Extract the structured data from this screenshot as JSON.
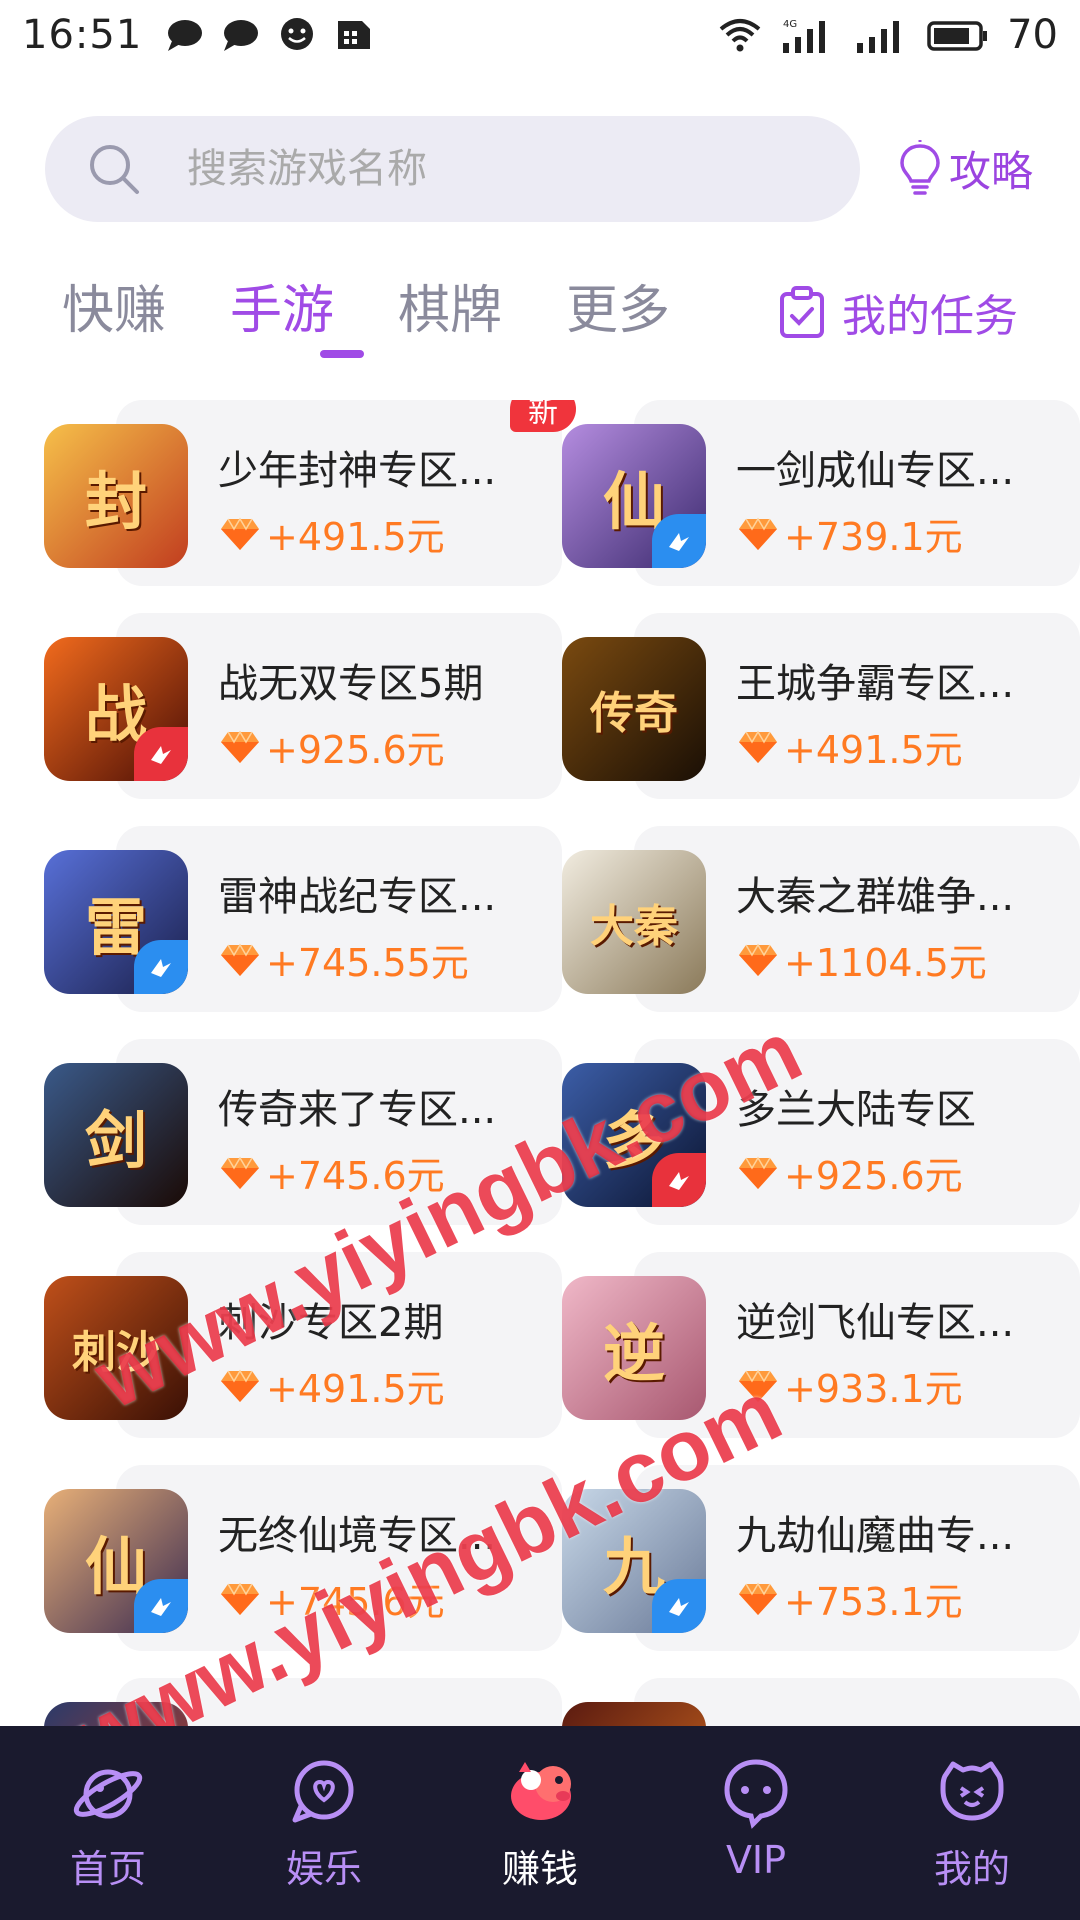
{
  "status_bar": {
    "time": "16:51",
    "left_icons": [
      "chat-bubble-icon",
      "chat-bubble-icon",
      "smile-chat-icon",
      "sim-card-icon"
    ],
    "right_icons": [
      "wifi-icon",
      "signal-4g-icon",
      "signal-icon",
      "battery-icon"
    ],
    "battery": "70"
  },
  "search": {
    "placeholder": "搜索游戏名称"
  },
  "guide": {
    "label": "攻略"
  },
  "tabs": [
    {
      "label": "快赚",
      "active": false
    },
    {
      "label": "手游",
      "active": true
    },
    {
      "label": "棋牌",
      "active": false
    },
    {
      "label": "更多",
      "active": false
    }
  ],
  "my_tasks": {
    "label": "我的任务"
  },
  "games": [
    {
      "name": "少年封神专区...",
      "reward": "+491.5元",
      "badge_new": "新",
      "icon_glyph": "封",
      "icon_colors": [
        "#f6c04a",
        "#c13d1f"
      ],
      "corner": ""
    },
    {
      "name": "一剑成仙专区...",
      "reward": "+739.1元",
      "badge_new": "",
      "icon_glyph": "仙",
      "icon_colors": [
        "#b58de0",
        "#3b2a6e"
      ],
      "corner": "blue"
    },
    {
      "name": "战无双专区5期",
      "reward": "+925.6元",
      "badge_new": "",
      "icon_glyph": "战",
      "icon_colors": [
        "#f26b1d",
        "#4a0d05"
      ],
      "corner": "red"
    },
    {
      "name": "王城争霸专区...",
      "reward": "+491.5元",
      "badge_new": "",
      "icon_glyph": "传奇",
      "icon_colors": [
        "#7a4a10",
        "#1a0f05"
      ],
      "corner": ""
    },
    {
      "name": "雷神战纪专区...",
      "reward": "+745.55元",
      "badge_new": "",
      "icon_glyph": "雷",
      "icon_colors": [
        "#5870d8",
        "#1a1f4a"
      ],
      "corner": "blue"
    },
    {
      "name": "大秦之群雄争...",
      "reward": "+1104.5元",
      "badge_new": "",
      "icon_glyph": "大秦",
      "icon_colors": [
        "#f1ece0",
        "#8b7a5a"
      ],
      "corner": ""
    },
    {
      "name": "传奇来了专区...",
      "reward": "+745.6元",
      "badge_new": "",
      "icon_glyph": "剑",
      "icon_colors": [
        "#3a5a8a",
        "#1a0a05"
      ],
      "corner": ""
    },
    {
      "name": "多兰大陆专区",
      "reward": "+925.6元",
      "badge_new": "",
      "icon_glyph": "多",
      "icon_colors": [
        "#3c5ea8",
        "#0b1430"
      ],
      "corner": "red"
    },
    {
      "name": "刺沙专区2期",
      "reward": "+491.5元",
      "badge_new": "",
      "icon_glyph": "刺沙",
      "icon_colors": [
        "#c0501a",
        "#3a1005"
      ],
      "corner": ""
    },
    {
      "name": "逆剑飞仙专区...",
      "reward": "+933.1元",
      "badge_new": "",
      "icon_glyph": "逆",
      "icon_colors": [
        "#f0b8c8",
        "#a85870"
      ],
      "corner": ""
    },
    {
      "name": "无终仙境专区...",
      "reward": "+745.6元",
      "badge_new": "",
      "icon_glyph": "仙",
      "icon_colors": [
        "#e8b078",
        "#3a2a50"
      ],
      "corner": "blue"
    },
    {
      "name": "九劫仙魔曲专...",
      "reward": "+753.1元",
      "badge_new": "",
      "icon_glyph": "九",
      "icon_colors": [
        "#c8d8e8",
        "#6a7a98"
      ],
      "corner": "blue"
    },
    {
      "name": "",
      "reward": "",
      "badge_new": "",
      "icon_glyph": "",
      "icon_colors": [
        "#2a3a6a",
        "#c03a20"
      ],
      "corner": ""
    },
    {
      "name": "",
      "reward": "",
      "badge_new": "",
      "icon_glyph": "",
      "icon_colors": [
        "#5a1a10",
        "#d06a20"
      ],
      "corner": ""
    }
  ],
  "watermarks": [
    "www.yiyingbk.com",
    "www.yiyingbk.com"
  ],
  "bottom_nav": [
    {
      "label": "首页",
      "icon": "planet-icon",
      "active": false
    },
    {
      "label": "娱乐",
      "icon": "heart-chat-icon",
      "active": false
    },
    {
      "label": "赚钱",
      "icon": "piggy-bank-icon",
      "active": true
    },
    {
      "label": "VIP",
      "icon": "vip-chat-icon",
      "active": false
    },
    {
      "label": "我的",
      "icon": "smile-face-icon",
      "active": false
    }
  ],
  "colors": {
    "accent": "#a04be6",
    "reward": "#ff7a22",
    "nav_bg": "#1a1a2e",
    "new_badge": "#f0343c",
    "watermark": "#e82234"
  }
}
